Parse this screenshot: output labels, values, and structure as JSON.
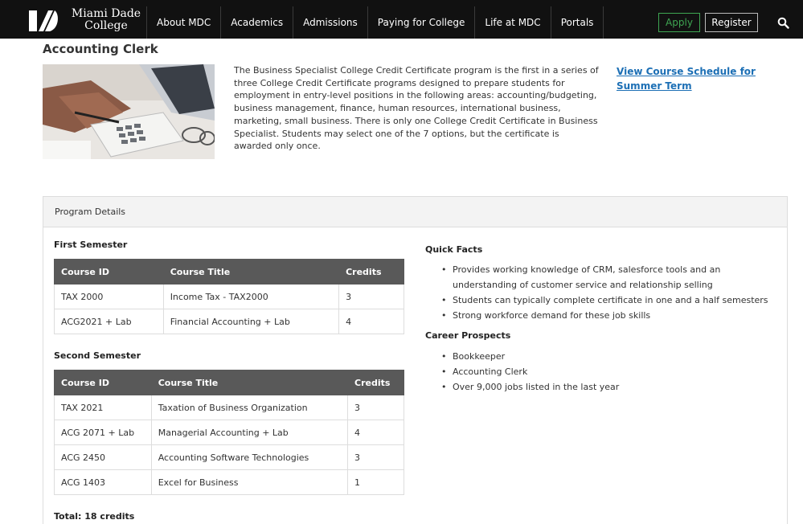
{
  "nav": {
    "logo_line1": "Miami Dade",
    "logo_line2": "College",
    "items": [
      "About MDC",
      "Academics",
      "Admissions",
      "Paying for College",
      "Life at MDC",
      "Portals"
    ],
    "apply_label": "Apply",
    "register_label": "Register",
    "search_icon": "search-icon",
    "apply_color": "#3ea652",
    "bar_color": "#111111"
  },
  "page": {
    "title": "Accounting Clerk",
    "intro": "The Business Specialist College Credit Certificate program is the first in a series of three College Credit Certificate programs designed to prepare students for employment in entry-level positions in the following areas: accounting/budgeting, business management, finance, human resources, international business, marketing, small business. There is only one College Credit Certificate in Business Specialist. Students may select one of the 7 options, but the certificate is awarded only once.",
    "schedule_link": "View Course Schedule for Summer Term",
    "link_color": "#1c6fb5"
  },
  "program": {
    "panel_title": "Program Details",
    "first_semester": {
      "title": "First Semester",
      "headers": [
        "Course ID",
        "Course Title",
        "Credits"
      ],
      "rows": [
        [
          "TAX 2000",
          "Income Tax - TAX2000",
          "3"
        ],
        [
          "ACG2021 + Lab",
          "Financial Accounting + Lab",
          "4"
        ]
      ]
    },
    "second_semester": {
      "title": "Second Semester",
      "headers": [
        "Course ID",
        "Course Title",
        "Credits"
      ],
      "rows": [
        [
          "TAX 2021",
          "Taxation of Business Organization",
          "3"
        ],
        [
          "ACG 2071 + Lab",
          "Managerial Accounting + Lab",
          "4"
        ],
        [
          "ACG 2450",
          "Accounting Software Technologies",
          "3"
        ],
        [
          "ACG 1403",
          "Excel for Business",
          "1"
        ]
      ]
    },
    "total": "Total: 18 credits",
    "quick_facts": {
      "title": "Quick Facts",
      "items": [
        "Provides working knowledge of CRM, salesforce tools and an understanding of customer service and relationship selling",
        "Students can typically complete certificate in one and a half semesters",
        "Strong workforce demand for these job skills"
      ]
    },
    "career_prospects": {
      "title": "Career Prospects",
      "items": [
        "Bookkeeper",
        "Accounting Clerk",
        "Over 9,000 jobs listed in the last year"
      ]
    },
    "header_color": "#595959"
  }
}
